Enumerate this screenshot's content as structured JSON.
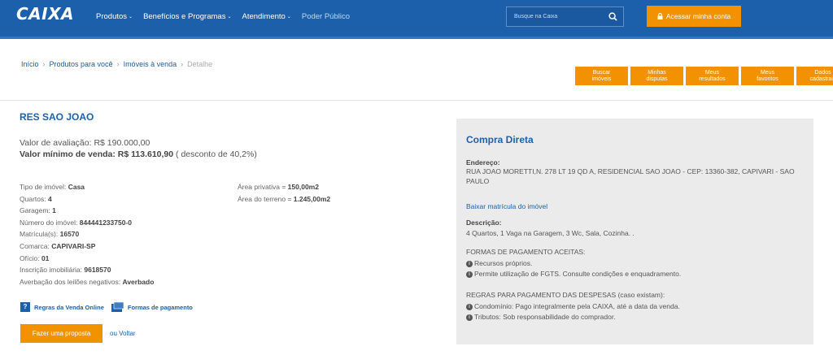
{
  "header": {
    "logo": "CAIXA",
    "nav": [
      {
        "label": "Produtos",
        "caret": "⌄"
      },
      {
        "label": "Benefícios e Programas",
        "caret": "⌄"
      },
      {
        "label": "Atendimento",
        "caret": "⌄"
      },
      {
        "label": "Poder Público",
        "caret": ""
      }
    ],
    "search_placeholder": "Busque na Caixa",
    "account_button": "Acessar minha conta",
    "colors": {
      "bar": "#1c60ab",
      "accent": "#f39200"
    }
  },
  "breadcrumb": {
    "items": [
      "Início",
      "Produtos para você",
      "Imóveis à venda"
    ],
    "current": "Detalhe",
    "separator": "›"
  },
  "quick_buttons": [
    [
      "Buscar",
      "imóveis"
    ],
    [
      "Minhas",
      "disputas"
    ],
    [
      "Meus",
      "resultados"
    ],
    [
      "Meus",
      "favoritos"
    ],
    [
      "Dados",
      "cadastrais"
    ]
  ],
  "property": {
    "title": "RES SAO JOAO",
    "valuation_label": "Valor de avaliação:",
    "valuation_value": "R$ 190.000,00",
    "min_sale_label": "Valor mínimo de venda:",
    "min_sale_value": "R$ 113.610,90",
    "discount": "( desconto de 40,2%)",
    "details_left": [
      {
        "label": "Tipo de imóvel:",
        "value": "Casa"
      },
      {
        "label": "Quartos:",
        "value": "4"
      },
      {
        "label": "Garagem:",
        "value": "1"
      },
      {
        "label": "Número do imóvel:",
        "value": "844441233750-0"
      },
      {
        "label": "Matrícula(s):",
        "value": "16570"
      },
      {
        "label": "Comarca:",
        "value": "CAPIVARI-SP"
      },
      {
        "label": "Ofício:",
        "value": "01"
      },
      {
        "label": "Inscrição imobiliária:",
        "value": "9618570"
      },
      {
        "label": "Averbação dos leilões negativos:",
        "value": "Averbado"
      }
    ],
    "details_right": [
      {
        "label": "Área privativa =",
        "value": "150,00m2"
      },
      {
        "label": "Área do terreno =",
        "value": "1.245,00m2"
      }
    ],
    "rules_link": "Regras da Venda Online",
    "payment_link": "Formas de pagamento",
    "proposal_button": "Fazer uma proposta",
    "back_link": "ou Voltar"
  },
  "panel": {
    "title": "Compra Direta",
    "address_label": "Endereço:",
    "address": "RUA JOAO MORETTI,N. 278 LT 19 QD A, RESIDENCIAL SAO JOAO - CEP: 13360-382, CAPIVARI - SAO PAULO",
    "matricula_link": "Baixar matrícula do imóvel",
    "description_label": "Descrição:",
    "description": "4 Quartos, 1 Vaga na Garagem, 3 Wc, Sala, Cozinha. .",
    "payment_heading": "FORMAS DE PAGAMENTO ACEITAS:",
    "payment_items": [
      "Recursos próprios.",
      "Permite utilização de FGTS. Consulte condições e enquadramento."
    ],
    "expenses_heading": "REGRAS PARA PAGAMENTO DAS DESPESAS (caso existam):",
    "expenses_items": [
      "Condomínio: Pago integralmente pela CAIXA, até a data da venda.",
      "Tributos: Sob responsabilidade do comprador."
    ]
  }
}
